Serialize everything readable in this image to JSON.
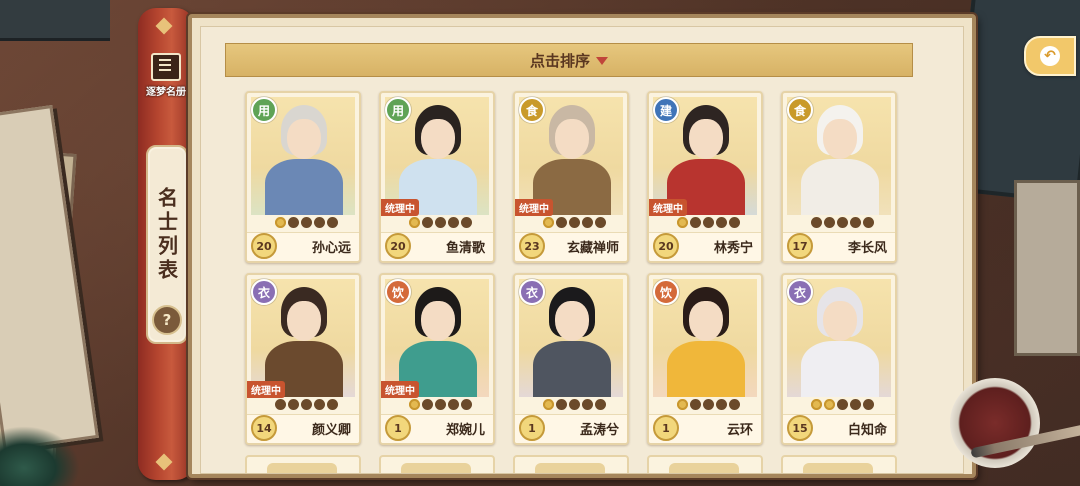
{
  "spine": {
    "book_button_label": "逐梦名册",
    "title": "名士列表",
    "help_label": "?"
  },
  "sort_bar": {
    "label": "点击排序"
  },
  "colors": {
    "type_badges": {
      "用": "#5fa356",
      "食": "#c99a2a",
      "建": "#3f74b8",
      "衣": "#8a6fb4",
      "饮": "#d46a3a"
    },
    "status_tag": "#c8542f"
  },
  "cards": [
    {
      "type": "用",
      "name": "孙心远",
      "level": "20",
      "status": "",
      "stars": 1,
      "hair": "#d9d6d0",
      "robe": "#6b88b5"
    },
    {
      "type": "用",
      "name": "鱼清歌",
      "level": "20",
      "status": "统理中",
      "stars": 1,
      "hair": "#2a2320",
      "robe": "#cfe1ef"
    },
    {
      "type": "食",
      "name": "玄藏禅师",
      "level": "23",
      "status": "统理中",
      "stars": 1,
      "hair": "#c9b8a4",
      "robe": "#8b6a43"
    },
    {
      "type": "建",
      "name": "林秀宁",
      "level": "20",
      "status": "统理中",
      "stars": 1,
      "hair": "#2e2522",
      "robe": "#b8342f"
    },
    {
      "type": "食",
      "name": "李长风",
      "level": "17",
      "status": "",
      "stars": 0,
      "hair": "#f4f2ee",
      "robe": "#f1ede6"
    },
    {
      "type": "衣",
      "name": "颜义卿",
      "level": "14",
      "status": "统理中",
      "stars": 0,
      "hair": "#3a2a22",
      "robe": "#6b4a2e"
    },
    {
      "type": "饮",
      "name": "郑婉儿",
      "level": "1",
      "status": "统理中",
      "stars": 1,
      "hair": "#1d1a19",
      "robe": "#3f9d8e"
    },
    {
      "type": "衣",
      "name": "孟涛兮",
      "level": "1",
      "status": "",
      "stars": 1,
      "hair": "#1b1a1c",
      "robe": "#4f5560"
    },
    {
      "type": "饮",
      "name": "云环",
      "level": "1",
      "status": "",
      "stars": 1,
      "hair": "#2a1c18",
      "robe": "#f0b73a"
    },
    {
      "type": "衣",
      "name": "白知命",
      "level": "15",
      "status": "",
      "stars": 2,
      "hair": "#e6e4e8",
      "robe": "#efeef2"
    }
  ]
}
